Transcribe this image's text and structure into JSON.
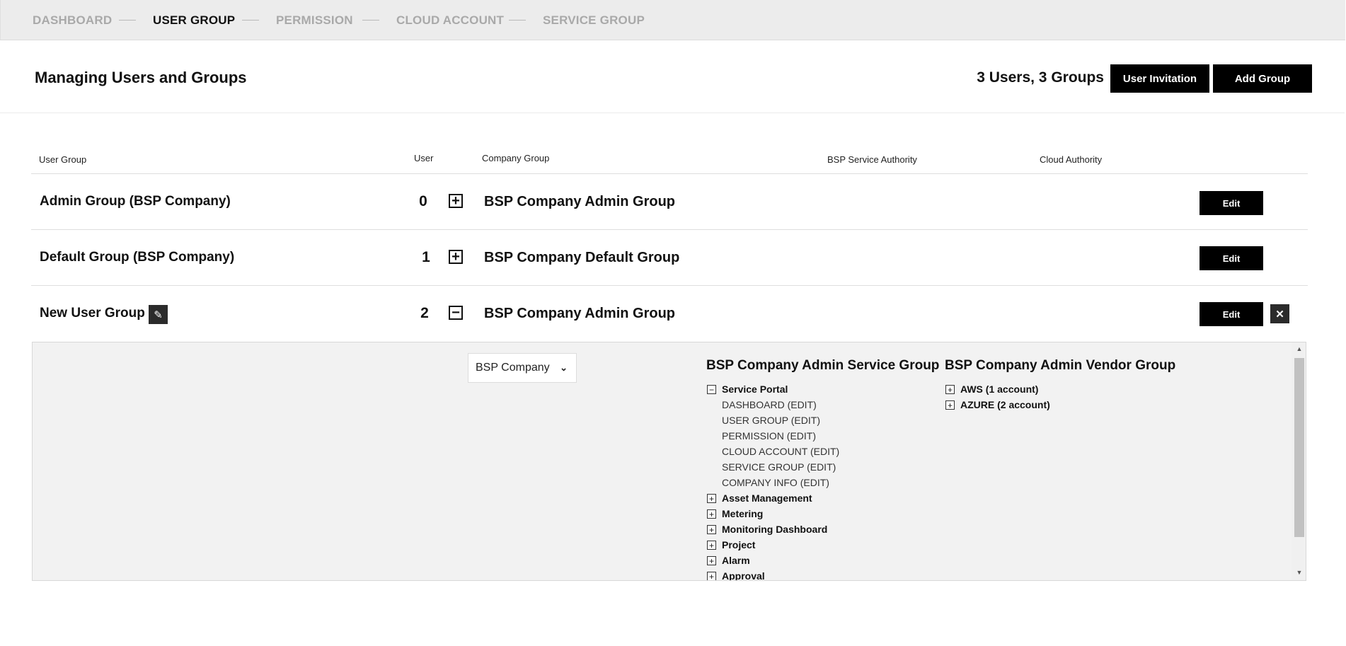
{
  "nav": {
    "items": [
      {
        "label": "DASHBOARD",
        "active": false
      },
      {
        "label": "USER GROUP",
        "active": true
      },
      {
        "label": "PERMISSION",
        "active": false
      },
      {
        "label": "CLOUD ACCOUNT",
        "active": false
      },
      {
        "label": "SERVICE GROUP",
        "active": false
      }
    ]
  },
  "header": {
    "title": "Managing Users and Groups",
    "summary": "3 Users, 3 Groups",
    "invite_label": "User Invitation",
    "add_group_label": "Add Group"
  },
  "table": {
    "columns": {
      "user_group": "User Group",
      "user": "User",
      "company_group": "Company Group",
      "service_authority": "BSP Service Authority",
      "cloud_authority": "Cloud Authority"
    },
    "rows": [
      {
        "name": "Admin Group (BSP Company)",
        "users": "0",
        "toggle": "+",
        "company_group": "BSP Company Admin Group",
        "edit_label": "Edit"
      },
      {
        "name": "Default Group (BSP Company)",
        "users": "1",
        "toggle": "+",
        "company_group": "BSP Company Default Group",
        "edit_label": "Edit"
      },
      {
        "name": "New User Group",
        "users": "2",
        "toggle": "−",
        "company_group": "BSP Company Admin Group",
        "edit_label": "Edit"
      }
    ]
  },
  "detail": {
    "company_select": "BSP Company",
    "service_group_title": "BSP Company Admin Service Group",
    "vendor_group_title": "BSP Company Admin Vendor Group",
    "service_tree": {
      "expanded": {
        "label": "Service Portal",
        "toggle": "−"
      },
      "children": [
        "DASHBOARD (EDIT)",
        "USER GROUP (EDIT)",
        "PERMISSION (EDIT)",
        "CLOUD ACCOUNT (EDIT)",
        "SERVICE GROUP (EDIT)",
        "COMPANY INFO (EDIT)"
      ],
      "collapsed": [
        "Asset Management",
        "Metering",
        "Monitoring Dashboard",
        "Project",
        "Alarm",
        "Approval"
      ]
    },
    "vendor_tree": [
      "AWS (1 account)",
      "AZURE (2 account)"
    ]
  },
  "icons": {
    "pencil": "pencil-icon",
    "close": "close-icon",
    "chevron": "chevron-down-icon"
  }
}
